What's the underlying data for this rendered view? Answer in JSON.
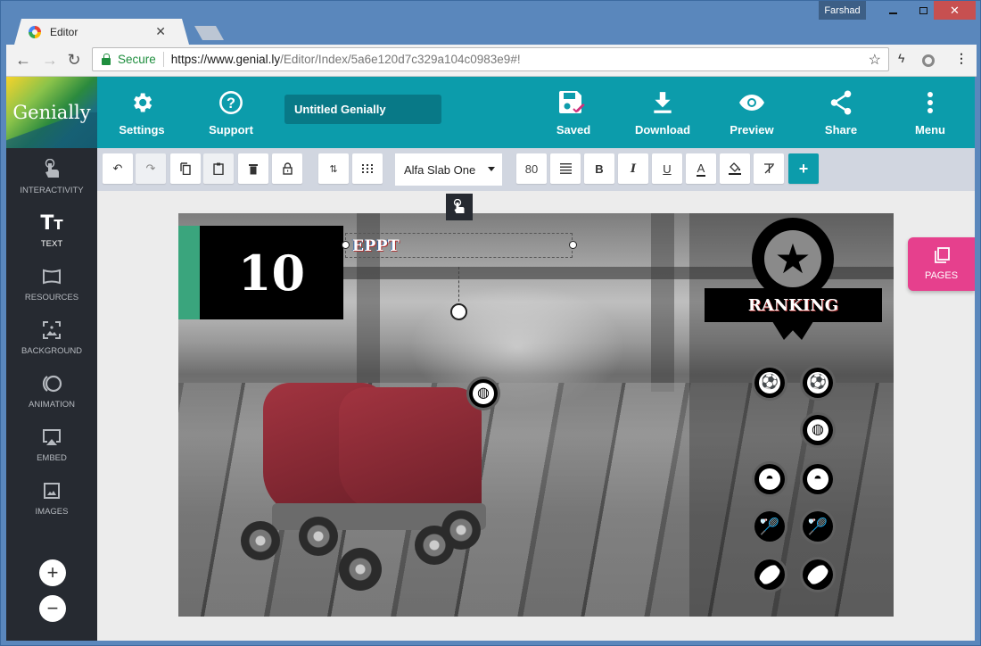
{
  "browser": {
    "tab_title": "Editor",
    "profile_name": "Farshad",
    "secure_label": "Secure",
    "url_host": "https://www.genial.ly",
    "url_path": "/Editor/Index/5a6e120d7c329a104c0983e9#!"
  },
  "app": {
    "logo_text": "Genially",
    "title": "Untitled Genially",
    "topbar": {
      "settings": "Settings",
      "support": "Support",
      "saved": "Saved",
      "download": "Download",
      "preview": "Preview",
      "share": "Share",
      "menu": "Menu"
    },
    "sidebar": {
      "items": [
        {
          "label": "INTERACTIVITY",
          "icon": "touch-icon"
        },
        {
          "label": "TEXT",
          "icon": "text-icon",
          "active": true
        },
        {
          "label": "RESOURCES",
          "icon": "resources-icon"
        },
        {
          "label": "BACKGROUND",
          "icon": "background-icon"
        },
        {
          "label": "ANIMATION",
          "icon": "animation-icon"
        },
        {
          "label": "EMBED",
          "icon": "embed-icon"
        },
        {
          "label": "IMAGES",
          "icon": "images-icon"
        }
      ],
      "zoom_in": "+",
      "zoom_out": "−"
    },
    "format_toolbar": {
      "font": "Alfa Slab One",
      "font_size": "80",
      "bold": "B",
      "italic": "I",
      "underline": "U",
      "color": "A",
      "add": "+"
    },
    "canvas": {
      "number_badge": "10",
      "selected_text": "EPPT",
      "ranking_label": "RANKING",
      "accent_green": "#3aa57d"
    },
    "pages_label": "PAGES",
    "colors": {
      "topbar": "#0c9cab",
      "sidebar": "#262a31",
      "pages": "#e6408d",
      "saved_check": "#d0307a"
    }
  }
}
